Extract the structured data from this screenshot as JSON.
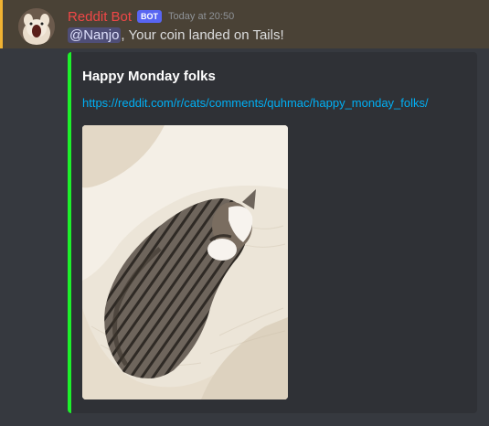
{
  "message": {
    "author": "Reddit Bot",
    "bot_tag": "BOT",
    "timestamp": "Today at 20:50",
    "mention": "@Nanjo",
    "text": ", Your coin landed on Tails!",
    "author_color": "#f04747",
    "highlight_color": "#f0b232"
  },
  "embed": {
    "title": "Happy Monday folks",
    "url": "https://reddit.com/r/cats/comments/quhmac/happy_monday_folks/",
    "accent_color": "#1df02b",
    "image_icon": "cat-photo"
  }
}
